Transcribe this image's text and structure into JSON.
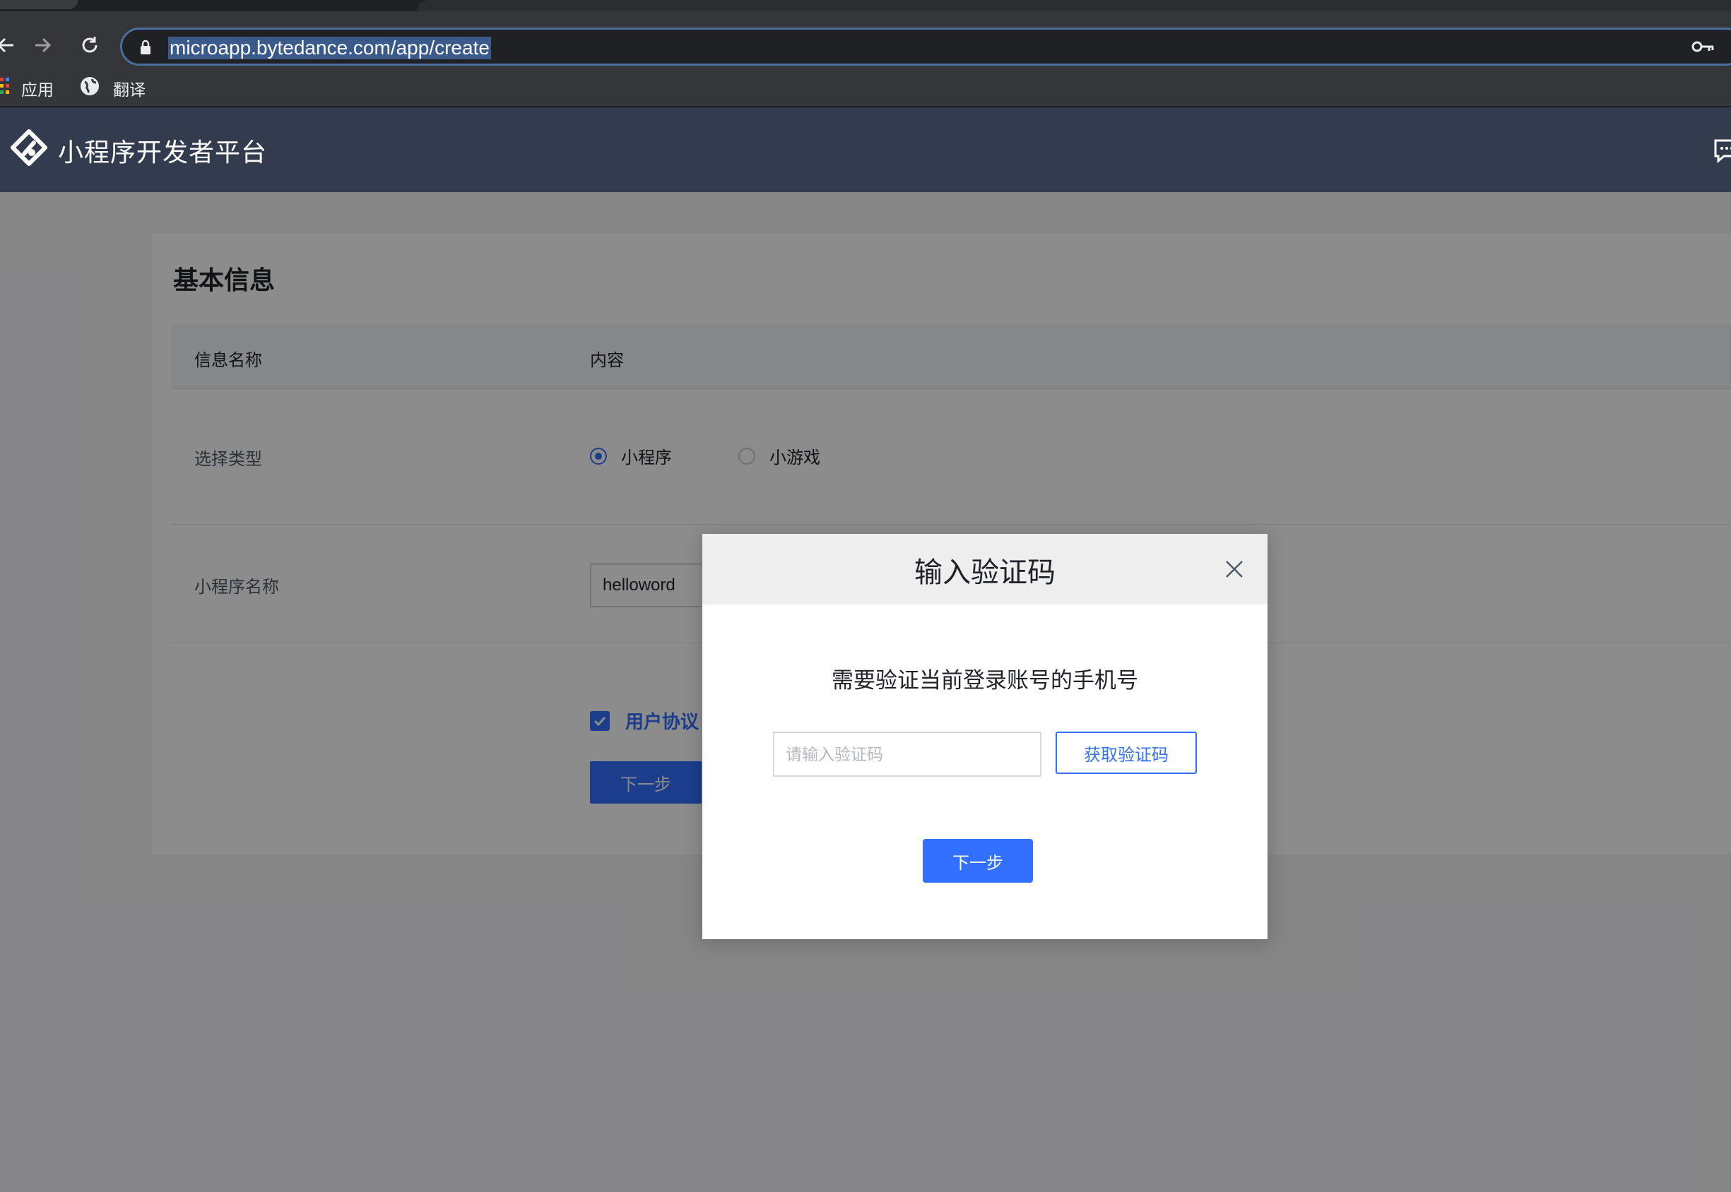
{
  "browser": {
    "url": "microapp.bytedance.com/app/create",
    "bookmarks": [
      {
        "label": "应用",
        "icon": "apps-grid-icon"
      },
      {
        "label": "翻译",
        "icon": "globe-icon"
      }
    ]
  },
  "header": {
    "brand": "小程序开发者平台"
  },
  "form": {
    "section_title": "基本信息",
    "columns": [
      "信息名称",
      "内容"
    ],
    "type_row": {
      "label": "选择类型",
      "options": [
        "小程序",
        "小游戏"
      ],
      "selected": "小程序"
    },
    "name_row": {
      "label": "小程序名称",
      "value": "helloword"
    },
    "agreement_text": "用户协议",
    "agreement_checked": true,
    "next_label": "下一步"
  },
  "modal": {
    "title": "输入验证码",
    "description": "需要验证当前登录账号的手机号",
    "code_placeholder": "请输入验证码",
    "get_code_label": "获取验证码",
    "next_label": "下一步"
  },
  "colors": {
    "accent": "#3370ff",
    "header_bg": "#333c4e",
    "overlay": "rgba(0,0,0,0.45)"
  }
}
